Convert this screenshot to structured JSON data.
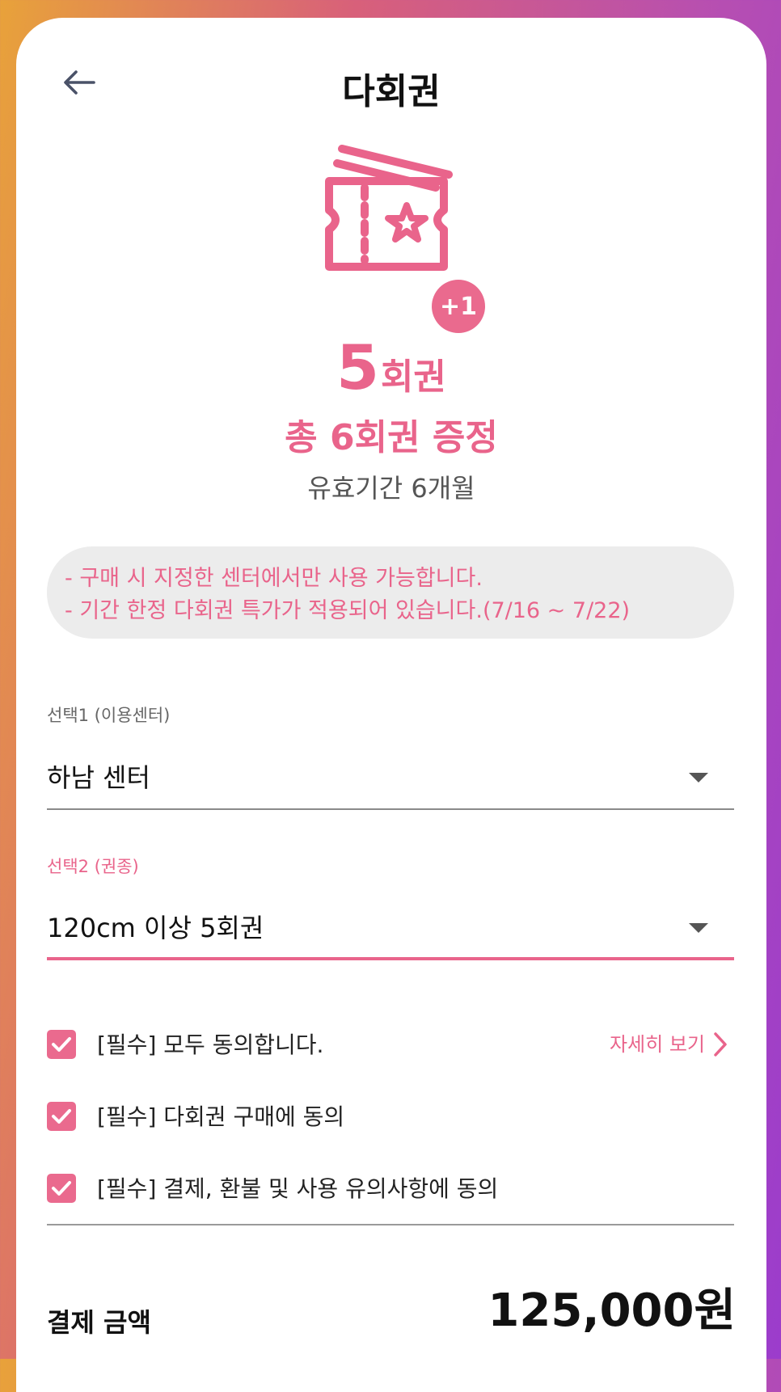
{
  "header": {
    "title": "다회권"
  },
  "product": {
    "bonus_badge": "+1",
    "count_number": "5",
    "count_unit": "회권",
    "bonus_text": "총 6회권 증정",
    "validity": "유효기간 6개월"
  },
  "notice": {
    "lines": [
      "- 구매 시 지정한 센터에서만 사용 가능합니다.",
      "- 기간 한정 다회권 특가가 적용되어 있습니다.(7/16 ~ 7/22)"
    ]
  },
  "select1": {
    "label": "선택1 (이용센터)",
    "value": "하남 센터"
  },
  "select2": {
    "label": "선택2 (권종)",
    "value": "120cm 이상 5회권"
  },
  "agreements": {
    "items": [
      {
        "label": "[필수] 모두 동의합니다.",
        "checked": true
      },
      {
        "label": "[필수] 다회권 구매에 동의",
        "checked": true
      },
      {
        "label": "[필수] 결제, 환불 및 사용 유의사항에 동의",
        "checked": true
      }
    ],
    "detail_link": "자세히 보기"
  },
  "payment": {
    "label": "결제 금액",
    "amount": "125,000원"
  },
  "colors": {
    "accent": "#e9648b",
    "checkbox": "#ea6a8e",
    "notice_bg": "#ececec"
  }
}
